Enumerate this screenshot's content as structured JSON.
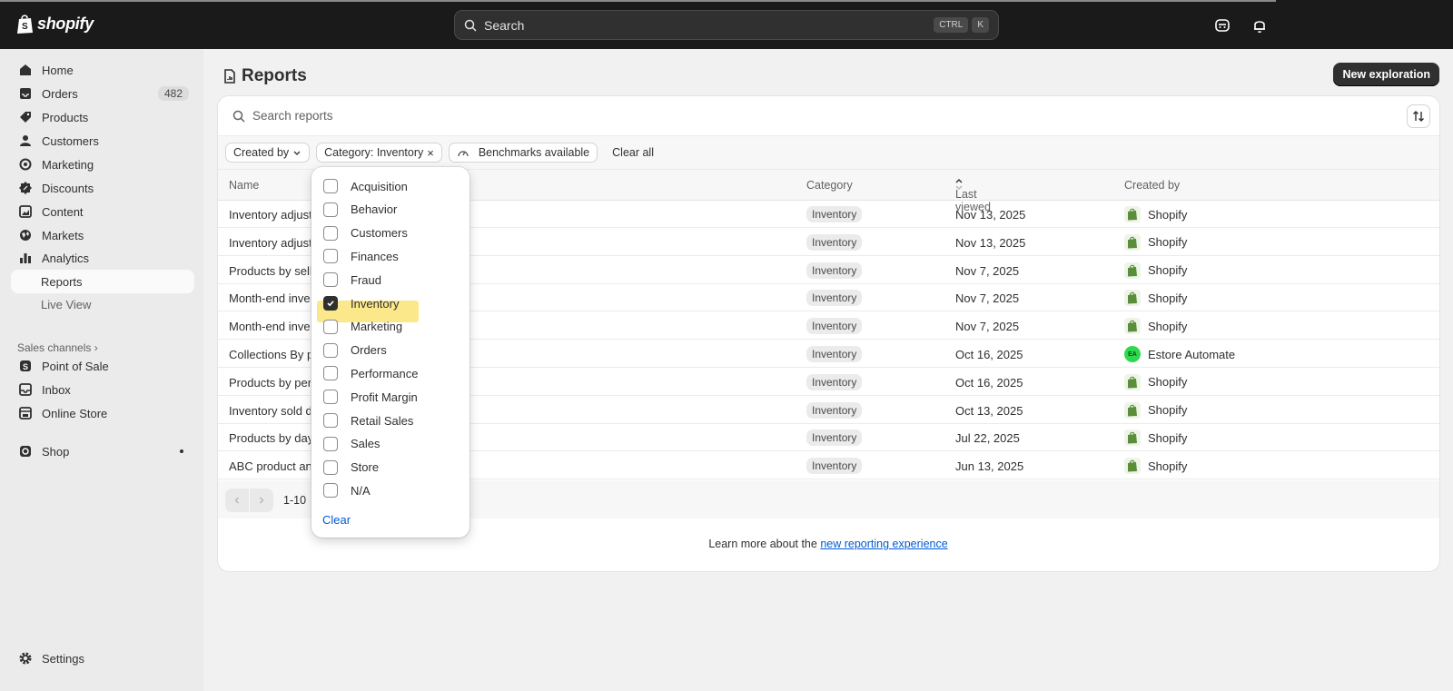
{
  "topbar": {
    "brand": "shopify",
    "search_placeholder": "Search",
    "shortcut_keys": [
      "CTRL",
      "K"
    ]
  },
  "sidebar": {
    "items": [
      {
        "label": "Home",
        "icon": "home-icon"
      },
      {
        "label": "Orders",
        "icon": "inbox-icon",
        "badge": "482"
      },
      {
        "label": "Products",
        "icon": "tag-icon"
      },
      {
        "label": "Customers",
        "icon": "person-icon"
      },
      {
        "label": "Marketing",
        "icon": "target-icon"
      },
      {
        "label": "Discounts",
        "icon": "discount-icon"
      },
      {
        "label": "Content",
        "icon": "content-icon"
      },
      {
        "label": "Markets",
        "icon": "globe-icon"
      },
      {
        "label": "Analytics",
        "icon": "chart-icon"
      },
      {
        "label": "Reports",
        "active": true
      },
      {
        "label": "Live View"
      }
    ],
    "sales_channels_label": "Sales channels",
    "channels": [
      {
        "label": "Point of Sale",
        "icon": "pos-icon"
      },
      {
        "label": "Inbox",
        "icon": "inbox-icon"
      },
      {
        "label": "Online Store",
        "icon": "store-icon"
      }
    ],
    "apps": [
      {
        "label": "Shop",
        "icon": "shop-icon"
      }
    ],
    "settings_label": "Settings"
  },
  "page": {
    "title": "Reports",
    "new_button": "New exploration",
    "search_placeholder": "Search reports",
    "filters": {
      "created_by": "Created by",
      "category": "Category: Inventory",
      "benchmarks": "Benchmarks available",
      "clear_all": "Clear all"
    },
    "columns": {
      "name": "Name",
      "category": "Category",
      "last_viewed": "Last viewed",
      "created_by": "Created by"
    },
    "rows": [
      {
        "name": "Inventory adjust",
        "category": "Inventory",
        "last_viewed": "Nov 13, 2025",
        "created_by": "Shopify"
      },
      {
        "name": "Inventory adjust",
        "category": "Inventory",
        "last_viewed": "Nov 13, 2025",
        "created_by": "Shopify"
      },
      {
        "name": "Products by sell",
        "category": "Inventory",
        "last_viewed": "Nov 7, 2025",
        "created_by": "Shopify"
      },
      {
        "name": "Month-end inve",
        "category": "Inventory",
        "last_viewed": "Nov 7, 2025",
        "created_by": "Shopify"
      },
      {
        "name": "Month-end inve",
        "category": "Inventory",
        "last_viewed": "Nov 7, 2025",
        "created_by": "Shopify"
      },
      {
        "name": "Collections By p",
        "category": "Inventory",
        "last_viewed": "Oct 16, 2025",
        "created_by": "Estore Automate",
        "initials": "EA"
      },
      {
        "name": "Products by per",
        "category": "Inventory",
        "last_viewed": "Oct 16, 2025",
        "created_by": "Shopify"
      },
      {
        "name": "Inventory sold d",
        "category": "Inventory",
        "last_viewed": "Oct 13, 2025",
        "created_by": "Shopify"
      },
      {
        "name": "Products by day",
        "category": "Inventory",
        "last_viewed": "Jul 22, 2025",
        "created_by": "Shopify"
      },
      {
        "name": "ABC product an",
        "category": "Inventory",
        "last_viewed": "Jun 13, 2025",
        "created_by": "Shopify"
      }
    ],
    "pagination": "1-10",
    "footer_text": "Learn more about the ",
    "footer_link": "new reporting experience"
  },
  "category_dropdown": {
    "options": [
      {
        "label": "Acquisition",
        "checked": false
      },
      {
        "label": "Behavior",
        "checked": false
      },
      {
        "label": "Customers",
        "checked": false
      },
      {
        "label": "Finances",
        "checked": false
      },
      {
        "label": "Fraud",
        "checked": false
      },
      {
        "label": "Inventory",
        "checked": true
      },
      {
        "label": "Marketing",
        "checked": false
      },
      {
        "label": "Orders",
        "checked": false
      },
      {
        "label": "Performance",
        "checked": false
      },
      {
        "label": "Profit Margin",
        "checked": false
      },
      {
        "label": "Retail Sales",
        "checked": false
      },
      {
        "label": "Sales",
        "checked": false
      },
      {
        "label": "Store",
        "checked": false
      },
      {
        "label": "N/A",
        "checked": false
      }
    ],
    "clear_label": "Clear"
  },
  "colors": {
    "topbar": "#1a1a1a",
    "accent_link": "#005bd3",
    "highlight": "#fbe88a",
    "primary_button": "#303030"
  }
}
